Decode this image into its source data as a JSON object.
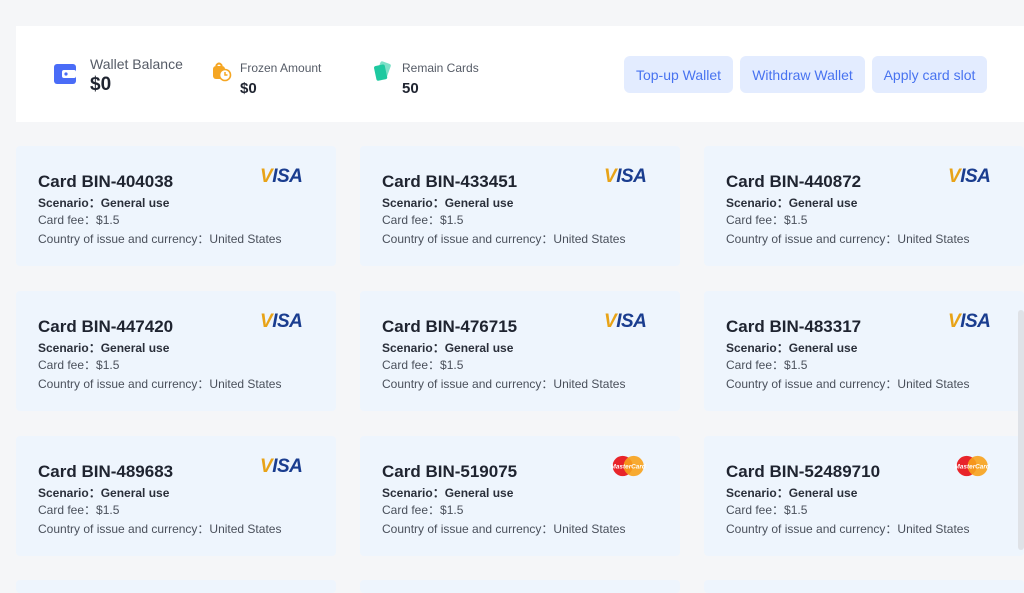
{
  "summary": {
    "wallet_balance": {
      "label": "Wallet Balance",
      "value": "$0"
    },
    "frozen_amount": {
      "label": "Frozen Amount",
      "value": "$0"
    },
    "remain_cards": {
      "label": "Remain Cards",
      "value": "50"
    }
  },
  "actions": {
    "topup_label": "Top-up Wallet",
    "withdraw_label": "Withdraw Wallet",
    "apply_label": "Apply card slot"
  },
  "cards": [
    {
      "title": "Card BIN-404038",
      "scenario": "Scenario：General use",
      "fee": "Card fee：$1.5",
      "country": "Country of issue and currency：United States",
      "brand": "VISA"
    },
    {
      "title": "Card BIN-433451",
      "scenario": "Scenario：General use",
      "fee": "Card fee：$1.5",
      "country": "Country of issue and currency：United States",
      "brand": "VISA"
    },
    {
      "title": "Card BIN-440872",
      "scenario": "Scenario：General use",
      "fee": "Card fee：$1.5",
      "country": "Country of issue and currency：United States",
      "brand": "VISA"
    },
    {
      "title": "Card BIN-447420",
      "scenario": "Scenario：General use",
      "fee": "Card fee：$1.5",
      "country": "Country of issue and currency：United States",
      "brand": "VISA"
    },
    {
      "title": "Card BIN-476715",
      "scenario": "Scenario：General use",
      "fee": "Card fee：$1.5",
      "country": "Country of issue and currency：United States",
      "brand": "VISA"
    },
    {
      "title": "Card BIN-483317",
      "scenario": "Scenario：General use",
      "fee": "Card fee：$1.5",
      "country": "Country of issue and currency：United States",
      "brand": "VISA"
    },
    {
      "title": "Card BIN-489683",
      "scenario": "Scenario：General use",
      "fee": "Card fee：$1.5",
      "country": "Country of issue and currency：United States",
      "brand": "VISA"
    },
    {
      "title": "Card BIN-519075",
      "scenario": "Scenario：General use",
      "fee": "Card fee：$1.5",
      "country": "Country of issue and currency：United States",
      "brand": "MasterCard"
    },
    {
      "title": "Card BIN-52489710",
      "scenario": "Scenario：General use",
      "fee": "Card fee：$1.5",
      "country": "Country of issue and currency：United States",
      "brand": "MasterCard"
    }
  ],
  "colors": {
    "accent": "#4873f0",
    "button_bg": "#e3ecff",
    "card_bg": "#eef5fd",
    "wallet_icon": "#4a6cf7",
    "frozen_icon": "#f5a623",
    "remain_icon": "#1ec9a0"
  }
}
